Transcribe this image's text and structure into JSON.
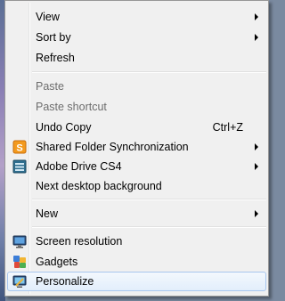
{
  "context_menu": {
    "items": [
      {
        "label": "View",
        "submenu": true
      },
      {
        "label": "Sort by",
        "submenu": true
      },
      {
        "label": "Refresh"
      },
      {
        "label": "Paste",
        "disabled": true
      },
      {
        "label": "Paste shortcut",
        "disabled": true
      },
      {
        "label": "Undo Copy",
        "shortcut": "Ctrl+Z"
      },
      {
        "label": "Shared Folder Synchronization",
        "submenu": true,
        "icon": "shared-folder-sync-icon"
      },
      {
        "label": "Adobe Drive CS4",
        "submenu": true,
        "icon": "adobe-drive-icon"
      },
      {
        "label": "Next desktop background"
      },
      {
        "label": "New",
        "submenu": true
      },
      {
        "label": "Screen resolution",
        "icon": "screen-resolution-icon"
      },
      {
        "label": "Gadgets",
        "icon": "gadgets-icon"
      },
      {
        "label": "Personalize",
        "icon": "personalize-icon",
        "highlighted": true
      }
    ]
  },
  "colors": {
    "menu_background": "#f0f0f0",
    "highlight_border": "#a8c6ee",
    "disabled_text": "#6d6d6d"
  }
}
